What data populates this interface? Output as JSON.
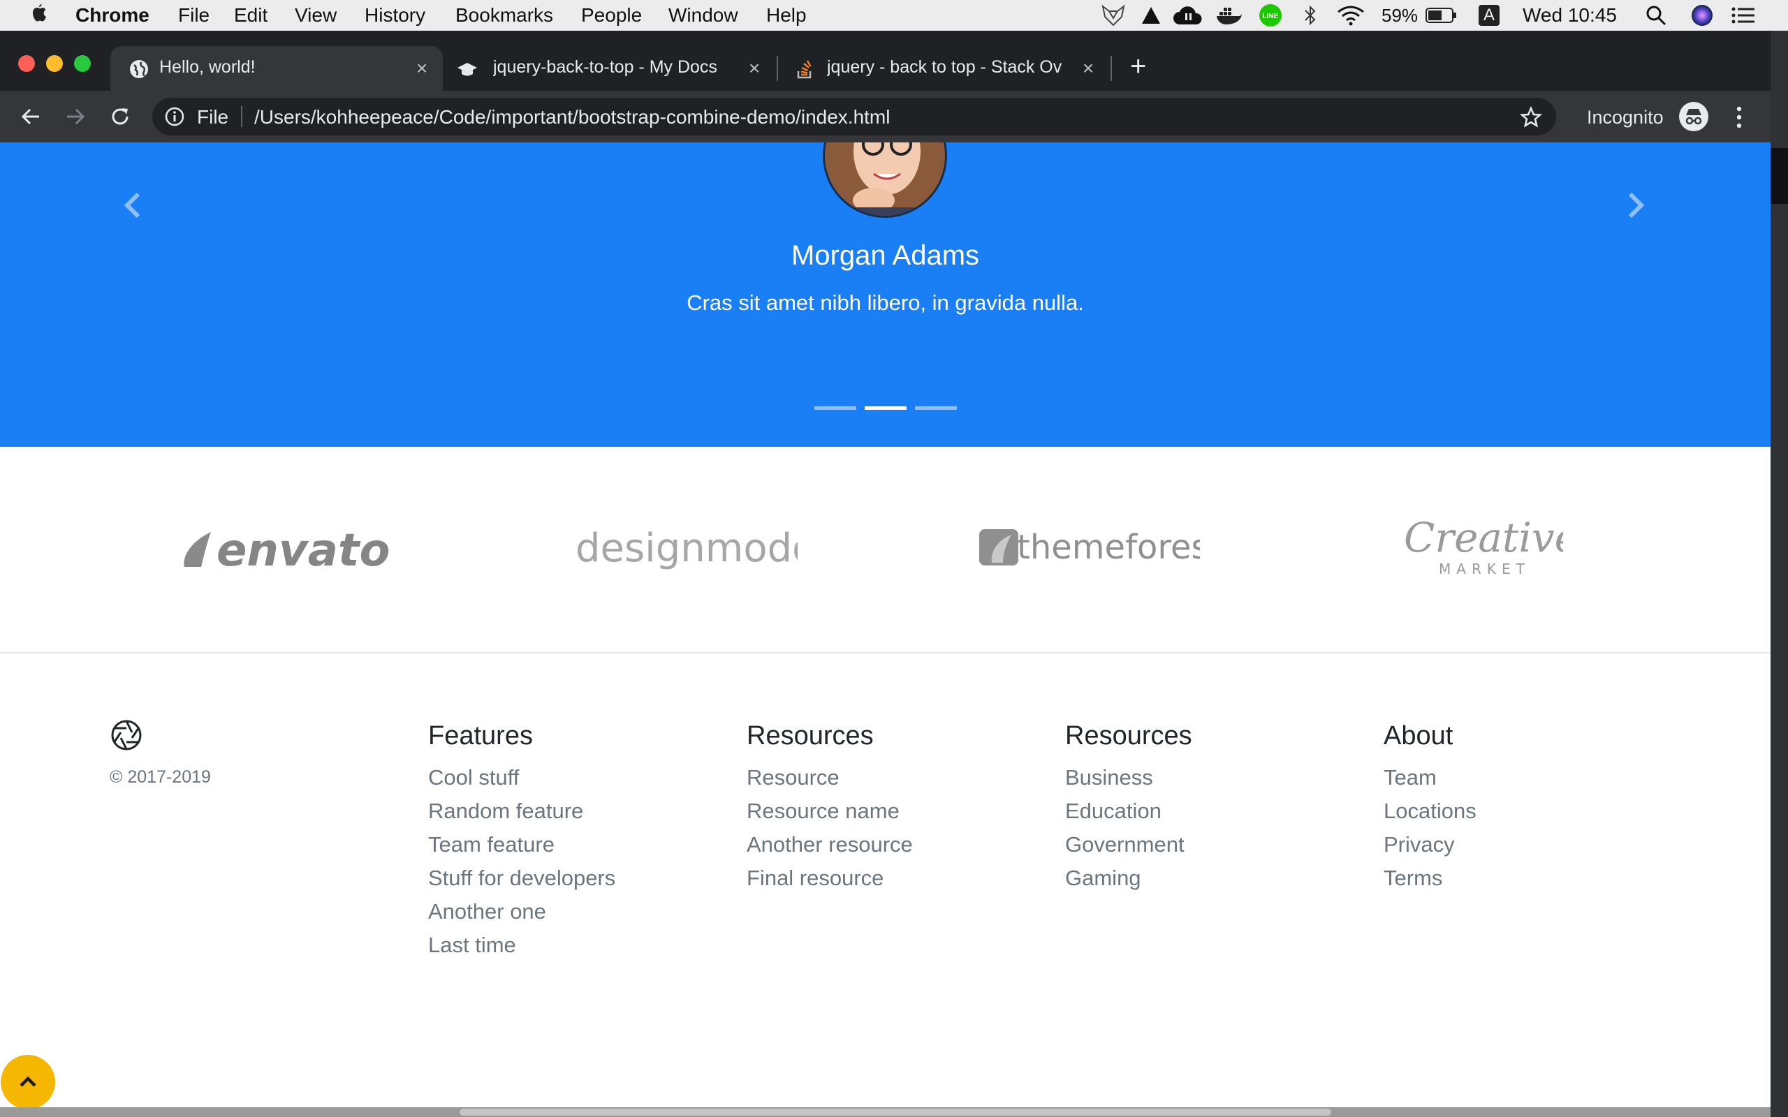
{
  "menubar": {
    "app": "Chrome",
    "items": [
      "File",
      "Edit",
      "View",
      "History",
      "Bookmarks",
      "People",
      "Window",
      "Help"
    ],
    "battery": "59%",
    "input_source": "A",
    "clock": "Wed 10:45"
  },
  "tabs": [
    {
      "title": "Hello, world!",
      "favicon": "globe-icon",
      "active": true
    },
    {
      "title": "jquery-back-to-top - My Docs",
      "favicon": "graduation-cap-icon",
      "active": false
    },
    {
      "title": "jquery - back to top - Stack Ov",
      "favicon": "stackoverflow-icon",
      "active": false
    }
  ],
  "new_tab_label": "+",
  "omnibox": {
    "scheme_label": "File",
    "url": "/Users/kohheepeace/Code/important/bootstrap-combine-demo/index.html"
  },
  "incognito_label": "Incognito",
  "carousel": {
    "name": "Morgan Adams",
    "text": "Cras sit amet nibh libero, in gravida nulla.",
    "active_slide_index": 1,
    "slide_count": 3
  },
  "logos": [
    {
      "name": "envato"
    },
    {
      "name": "designmodo"
    },
    {
      "name": "themeforest"
    },
    {
      "name": "Creative",
      "sub": "MARKET"
    }
  ],
  "footer": {
    "copyright": "© 2017-2019",
    "columns": [
      {
        "heading": "Features",
        "links": [
          "Cool stuff",
          "Random feature",
          "Team feature",
          "Stuff for developers",
          "Another one",
          "Last time"
        ]
      },
      {
        "heading": "Resources",
        "links": [
          "Resource",
          "Resource name",
          "Another resource",
          "Final resource"
        ]
      },
      {
        "heading": "Resources",
        "links": [
          "Business",
          "Education",
          "Government",
          "Gaming"
        ]
      },
      {
        "heading": "About",
        "links": [
          "Team",
          "Locations",
          "Privacy",
          "Terms"
        ]
      }
    ]
  },
  "colors": {
    "carousel_bg": "#1a7ef5",
    "back_to_top_bg": "#f5b700",
    "link_gray": "#6c757d"
  }
}
